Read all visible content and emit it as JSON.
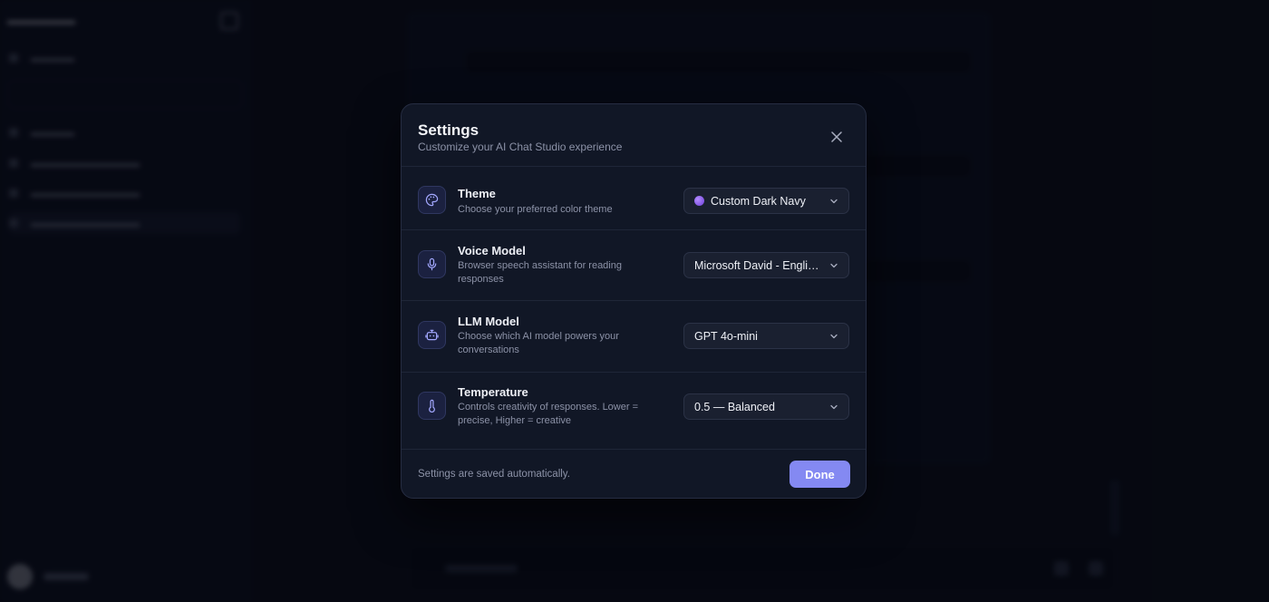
{
  "modal": {
    "title": "Settings",
    "subtitle": "Customize your AI Chat Studio experience",
    "footer_note": "Settings are saved automatically.",
    "done_label": "Done"
  },
  "settings": [
    {
      "title": "Theme",
      "description": "Choose your preferred color theme",
      "value": "Custom Dark Navy",
      "icon": "palette-icon",
      "swatch_color": "#8b5cf6"
    },
    {
      "title": "Voice Model",
      "description": "Browser speech assistant for reading responses",
      "value": "Microsoft David - English (United States)",
      "icon": "microphone-icon"
    },
    {
      "title": "LLM Model",
      "description": "Choose which AI model powers your conversations",
      "value": "GPT 4o-mini",
      "icon": "robot-icon"
    },
    {
      "title": "Temperature",
      "description": "Controls creativity of responses. Lower = precise, Higher = creative",
      "value": "0.5 — Balanced",
      "icon": "thermometer-icon"
    }
  ],
  "colors": {
    "accent": "#8489f2",
    "icon_tint": "#a3a8ff",
    "background": "#0a0d18",
    "modal_background": "#111726"
  }
}
